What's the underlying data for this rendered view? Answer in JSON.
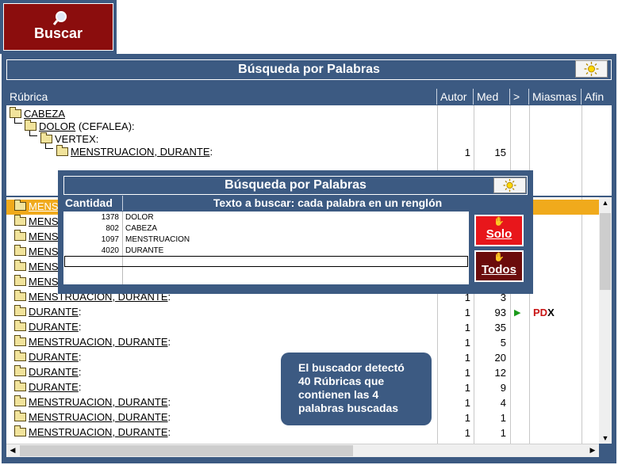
{
  "search_button": {
    "label": "Buscar",
    "icon": "magnifier-icon"
  },
  "main": {
    "title": "Búsqueda por Palabras",
    "columns": [
      "Rúbrica",
      "Autor",
      "Med",
      ">",
      "Miasmas",
      "Afin"
    ]
  },
  "tree": [
    {
      "label": "CABEZA",
      "suffix": ""
    },
    {
      "label": "DOLOR",
      "suffix": " (CEFALEA):"
    },
    {
      "label": "VERTEX:",
      "suffix": ""
    },
    {
      "label": "MENSTRUACION, DURANTE",
      "suffix": ":",
      "autor": "1",
      "med": "15"
    }
  ],
  "results": [
    {
      "label": "MENST",
      "suffix": "",
      "autor": "",
      "med": ""
    },
    {
      "label": "MENST",
      "suffix": "",
      "autor": "",
      "med": ""
    },
    {
      "label": "MENST",
      "suffix": "",
      "autor": "",
      "med": ""
    },
    {
      "label": "MENST",
      "suffix": "",
      "autor": "",
      "med": ""
    },
    {
      "label": "MENST",
      "suffix": "",
      "autor": "",
      "med": ""
    },
    {
      "label": "MENST",
      "suffix": "",
      "autor": "",
      "med": ""
    },
    {
      "label": "MENSTRUACION, DURANTE",
      "suffix": ":",
      "autor": "1",
      "med": "3"
    },
    {
      "label": "DURANTE",
      "suffix": ":",
      "autor": "1",
      "med": "93",
      "gt": "▶",
      "pd": "PD",
      "x": "X"
    },
    {
      "label": "DURANTE",
      "suffix": ":",
      "autor": "1",
      "med": "35"
    },
    {
      "label": "MENSTRUACION, DURANTE",
      "suffix": ":",
      "autor": "1",
      "med": "5"
    },
    {
      "label": "DURANTE",
      "suffix": ":",
      "autor": "1",
      "med": "20"
    },
    {
      "label": "DURANTE",
      "suffix": ":",
      "autor": "1",
      "med": "12"
    },
    {
      "label": "DURANTE",
      "suffix": ":",
      "autor": "1",
      "med": "9"
    },
    {
      "label": "MENSTRUACION, DURANTE",
      "suffix": ":",
      "autor": "1",
      "med": "4"
    },
    {
      "label": "MENSTRUACION, DURANTE",
      "suffix": ":",
      "autor": "1",
      "med": "1"
    },
    {
      "label": "MENSTRUACION, DURANTE",
      "suffix": ":",
      "autor": "1",
      "med": "1"
    }
  ],
  "dialog": {
    "title": "Búsqueda por Palabras",
    "col_count": "Cantidad",
    "col_text": "Texto a buscar: cada palabra  en un renglón",
    "terms": [
      {
        "count": "1378",
        "text": "DOLOR"
      },
      {
        "count": "802",
        "text": "CABEZA"
      },
      {
        "count": "1097",
        "text": "MENSTRUACION"
      },
      {
        "count": "4020",
        "text": "DURANTE"
      }
    ],
    "btn_solo": "Solo",
    "btn_todos": "Todos"
  },
  "info": {
    "lines": [
      "El buscador detectó",
      "40  Rúbricas que",
      "contienen las 4",
      "palabras buscadas"
    ]
  },
  "colors": {
    "panel": "#3c5a82",
    "button_red": "#8b0d0d",
    "selected_row": "#f0aa1c",
    "solo": "#e8161b",
    "todos": "#6b0c0c"
  }
}
